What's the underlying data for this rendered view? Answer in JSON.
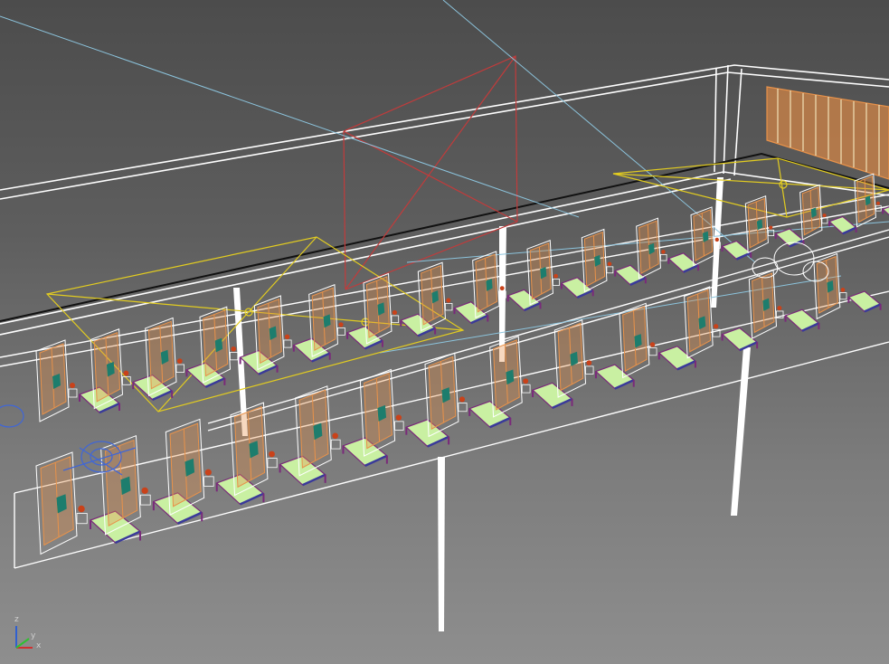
{
  "viewport": {
    "background": "#5a5a5a",
    "colors": {
      "wire_white": "#ffffff",
      "wire_orange": "#e8924a",
      "light_yellow": "#e2cc20",
      "camera_red": "#c23b3b",
      "guide_blue": "#8cc4dd",
      "bed_green": "#c9f0a2",
      "bed_frame": "#7a2a7a",
      "cabinet_teal": "#1d7d6d",
      "ball_red": "#c9421a",
      "cam_blue": "#3f66d8"
    },
    "bay_count_upper_row": 16,
    "bay_count_lower_row": 13
  },
  "axis_gizmo": {
    "z_label": "z",
    "x_label": "x",
    "y_label": "y",
    "x_color": "#d03030",
    "y_color": "#30c030",
    "z_color": "#3060d0"
  }
}
